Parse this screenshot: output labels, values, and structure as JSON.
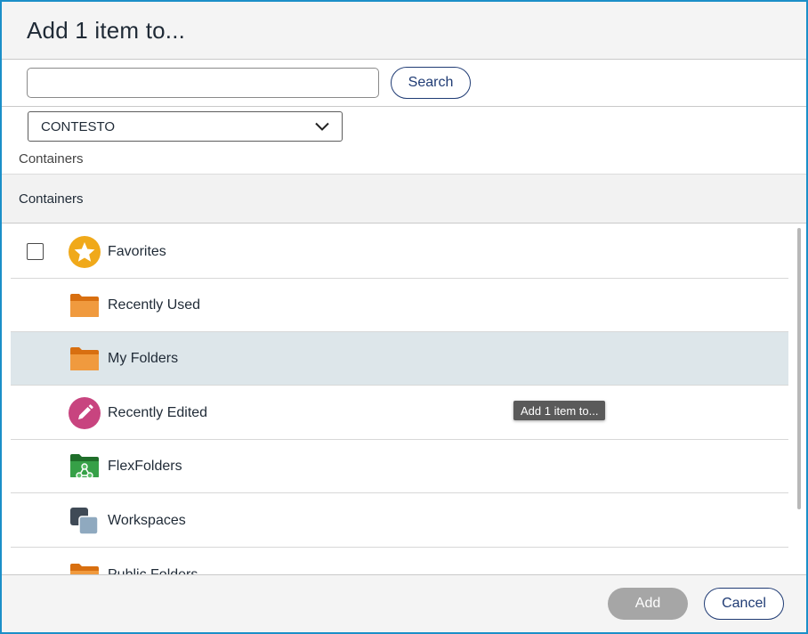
{
  "dialog": {
    "title": "Add 1 item to..."
  },
  "search": {
    "value": "",
    "placeholder": "",
    "button_label": "Search"
  },
  "source_select": {
    "selected": "CONTESTO"
  },
  "breadcrumb": "Containers",
  "section_header": "Containers",
  "items": [
    {
      "label": "Favorites",
      "icon": "star-icon",
      "has_checkbox": true,
      "highlighted": false
    },
    {
      "label": "Recently Used",
      "icon": "folder-icon",
      "has_checkbox": false,
      "highlighted": false
    },
    {
      "label": "My Folders",
      "icon": "folder-icon",
      "has_checkbox": false,
      "highlighted": true
    },
    {
      "label": "Recently Edited",
      "icon": "pencil-icon",
      "has_checkbox": false,
      "highlighted": false
    },
    {
      "label": "FlexFolders",
      "icon": "flexfolder-icon",
      "has_checkbox": false,
      "highlighted": false
    },
    {
      "label": "Workspaces",
      "icon": "workspaces-icon",
      "has_checkbox": false,
      "highlighted": false
    },
    {
      "label": "Public Folders",
      "icon": "folder-icon",
      "has_checkbox": false,
      "highlighted": false
    }
  ],
  "tooltip": "Add 1 item to...",
  "footer": {
    "add_label": "Add",
    "cancel_label": "Cancel",
    "add_enabled": false
  },
  "colors": {
    "accent": "#1f3b74",
    "border_focus": "#1b8fc8",
    "folder": "#e8821e",
    "star": "#f0a91a",
    "pencil": "#c8447f",
    "flexfolder": "#2e8b3a",
    "workspaces_dark": "#3f4a56",
    "workspaces_light": "#8fa9bf",
    "highlight_row": "#dde6ea",
    "disabled_button": "#a6a6a6"
  }
}
